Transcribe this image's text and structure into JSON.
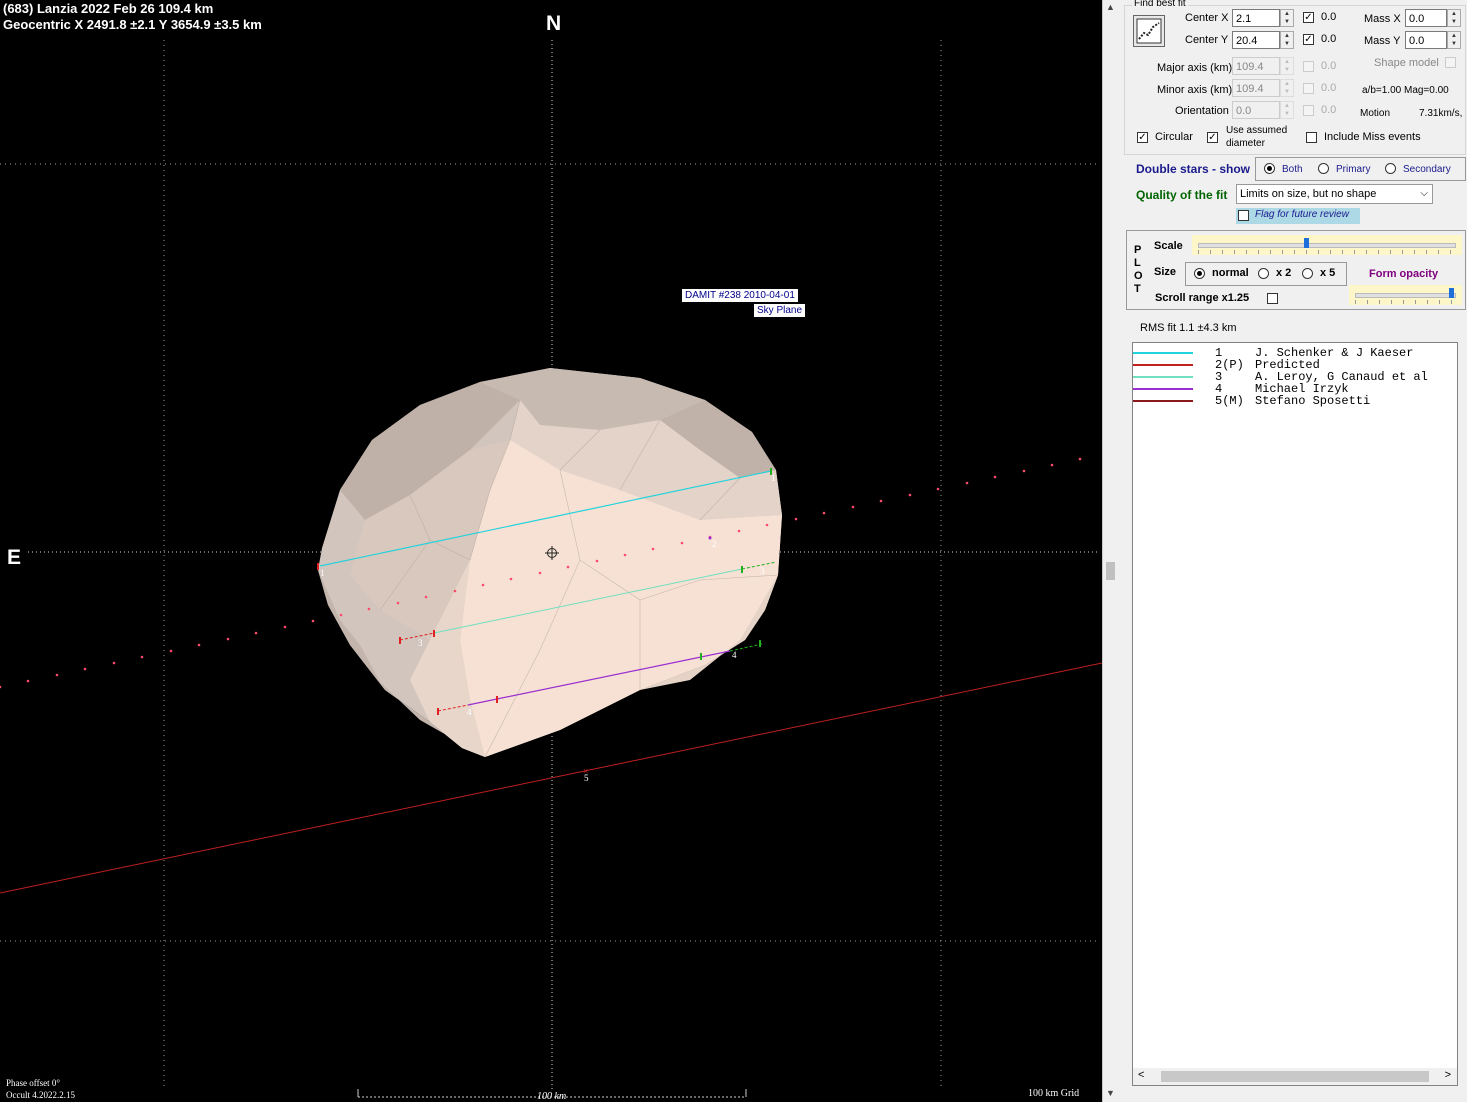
{
  "header": {
    "line1": "(683) Lanzia  2022 Feb 26   109.4 km",
    "line2": "Geocentric  X  2491.8 ±2.1  Y 3654.9 ±3.5 km"
  },
  "plot": {
    "north_label": "N",
    "east_label": "E",
    "damit_label": "DAMIT #238 2010-04-01",
    "sky_plane_label": "Sky Plane",
    "phase_offset": "Phase offset 0°",
    "version": "Occult 4.2022.2.15",
    "scale_bar_label": "100 km",
    "grid_label": "100 km Grid",
    "chord_labels": [
      "1",
      "1",
      "2",
      "3",
      "3",
      "4",
      "4",
      "5"
    ],
    "colors": {
      "background": "#000000",
      "shape": "#efddd2",
      "chord1": "#22d3dd",
      "chord2_predicted": "#c02020",
      "chord3": "#6fe0c0",
      "chord4": "#9a2ed0",
      "chord5": "#8b1a1a"
    }
  },
  "panel": {
    "find_best_fit": "Find best fit",
    "center_x_label": "Center X",
    "center_x_value": "2.1",
    "center_x_check": "0.0",
    "center_y_label": "Center Y",
    "center_y_value": "20.4",
    "center_y_check": "0.0",
    "mass_x_label": "Mass X",
    "mass_x_value": "0.0",
    "mass_y_label": "Mass Y",
    "mass_y_value": "0.0",
    "shape_model_label": "Shape model",
    "major_axis_label": "Major axis (km)",
    "major_axis_value": "109.4",
    "major_axis_check": "0.0",
    "minor_axis_label": "Minor axis (km)",
    "minor_axis_value": "109.4",
    "minor_axis_check": "0.0",
    "orientation_label": "Orientation",
    "orientation_value": "0.0",
    "orientation_check": "0.0",
    "ab_mag": "a/b=1.00  Mag=0.00",
    "motion_label": "Motion",
    "motion_value": "7.31km/s,",
    "circular_label": "Circular",
    "use_assumed_label_1": "Use assumed",
    "use_assumed_label_2": "diameter",
    "include_miss_label": "Include Miss events",
    "double_stars_label": "Double stars - show",
    "ds_both": "Both",
    "ds_primary": "Primary",
    "ds_secondary": "Secondary",
    "quality_label": "Quality of the fit",
    "quality_value": "Limits on size, but no shape",
    "flag_review_label": "Flag for future review",
    "plot_vertical_label": [
      "P",
      "L",
      "O",
      "T"
    ],
    "scale_label": "Scale",
    "scale_position": 0.42,
    "size_label": "Size",
    "size_normal": "normal",
    "size_x2": "x 2",
    "size_x5": "x 5",
    "form_opacity_label": "Form opacity",
    "opacity_position": 0.98,
    "scroll_range_label": "Scroll range x1.25",
    "rms_fit": "RMS fit  1.1 ±4.3 km"
  },
  "legend": [
    {
      "num": "1",
      "name": "J. Schenker & J Kaeser",
      "color": "#22d3dd"
    },
    {
      "num": "2(P)",
      "name": "Predicted",
      "color": "#c02020"
    },
    {
      "num": "3",
      "name": "A. Leroy, G Canaud et al",
      "color": "#6fe0c0"
    },
    {
      "num": "4",
      "name": "Michael Irzyk",
      "color": "#9a2ed0"
    },
    {
      "num": "5(M)",
      "name": "Stefano Sposetti",
      "color": "#8b1a1a"
    }
  ]
}
